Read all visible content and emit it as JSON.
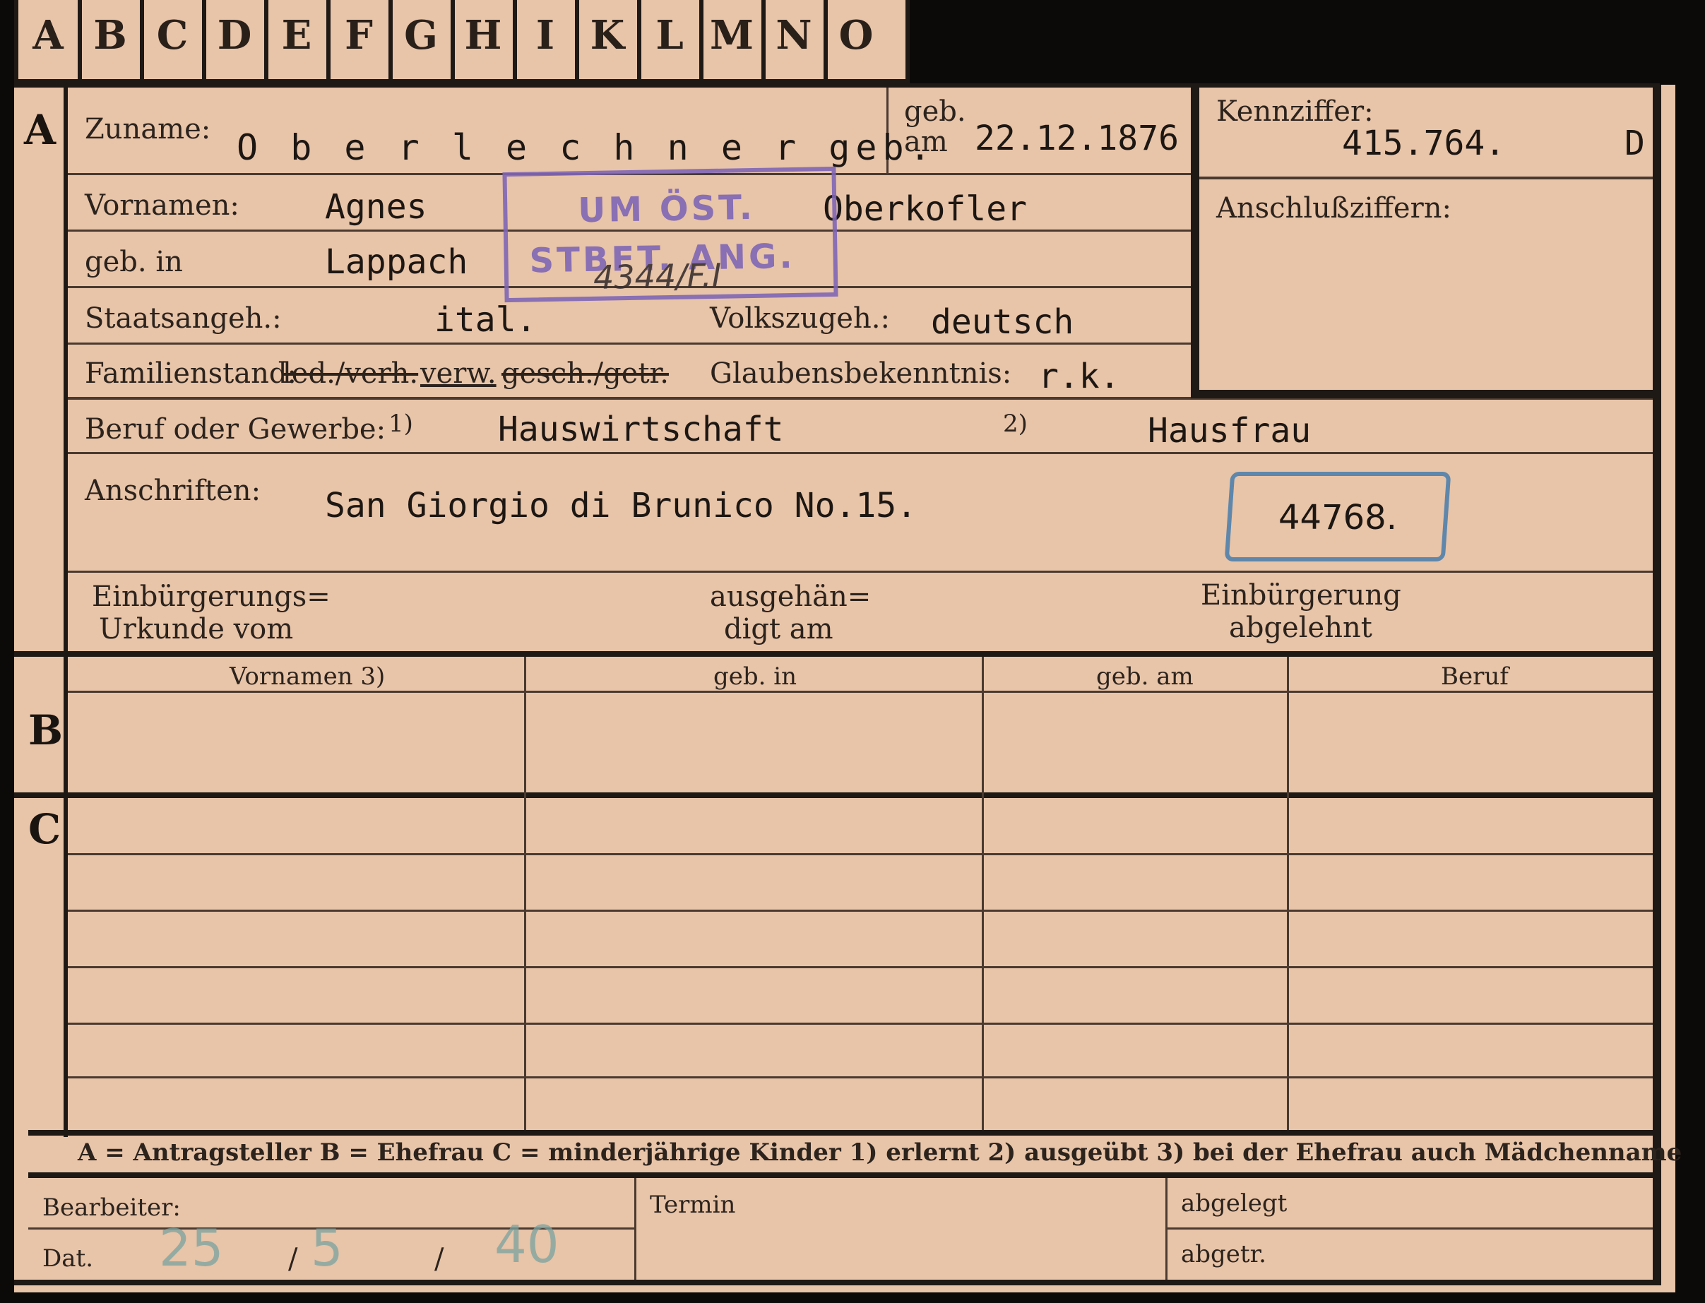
{
  "tabs": [
    "A",
    "B",
    "C",
    "D",
    "E",
    "F",
    "G",
    "H",
    "I",
    "K",
    "L",
    "M",
    "N",
    "O"
  ],
  "sections": {
    "a": "A",
    "b": "B",
    "c": "C"
  },
  "fields": {
    "zuname_label": "Zuname:",
    "zuname_value": "O b e r l e c h n e r  geb.",
    "geb_am_label_1": "geb.",
    "geb_am_label_2": "am",
    "geb_am_value": "22.12.1876",
    "kennziffer_label": "Kennziffer:",
    "kennziffer_value": "415.764.",
    "kennziffer_suffix": "D",
    "vornamen_label": "Vornamen:",
    "vornamen_value": "Agnes",
    "maiden_name": "Oberkofler",
    "anschlussziffern_label": "Anschlußziffern:",
    "geb_in_label": "geb. in",
    "geb_in_value": "Lappach",
    "staatsangeh_label": "Staatsangeh.:",
    "staatsangeh_value": "ital.",
    "volkszugeh_label": "Volkszugeh.:",
    "volkszugeh_value": "deutsch",
    "familienstand_label": "Familienstand:",
    "familienstand_struck_1": "led./verh.",
    "familienstand_selected": "verw.",
    "familienstand_struck_2": "gesch./getr.",
    "glaubens_label": "Glaubensbekenntnis:",
    "glaubens_value": "r.k.",
    "beruf_label": "Beruf oder Gewerbe:",
    "beruf_note1": "1)",
    "beruf_value1": "Hauswirtschaft",
    "beruf_note2": "2)",
    "beruf_value2": "Hausfrau",
    "anschriften_label": "Anschriften:",
    "anschriften_value": "San Giorgio di Brunico No.15.",
    "boxed_number": "44768.",
    "einbuergerung_label_1": "Einbürgerungs=",
    "einbuergerung_label_2": "Urkunde vom",
    "ausgehaendigt_label_1": "ausgehän=",
    "ausgehaendigt_label_2": "digt am",
    "abgelehnt_label_1": "Einbürgerung",
    "abgelehnt_label_2": "abgelehnt"
  },
  "stamp": {
    "line1": "UM ÖST.",
    "line2": "STBFT. ANG.",
    "handwritten": "4344/F.I"
  },
  "section_b_headers": [
    "Vornamen 3)",
    "geb. in",
    "geb. am",
    "Beruf"
  ],
  "legend": "A = Antragsteller   B = Ehefrau   C = minderjährige Kinder   1) erlernt   2) ausgeübt   3) bei der Ehefrau auch Mädchenname",
  "footer": {
    "bearbeiter_label": "Bearbeiter:",
    "dat_label": "Dat.",
    "date_day": "25",
    "sep1": "/",
    "date_month": "5",
    "sep2": "/",
    "date_year": "40",
    "termin_label": "Termin",
    "abgelegt_label": "abgelegt",
    "abgetr_label": "abgetr."
  },
  "colors": {
    "card": "#e8c4a8",
    "stamp": "#7f66b5",
    "blue_box": "#5f87ab",
    "pencil": "#7aa3a0"
  }
}
